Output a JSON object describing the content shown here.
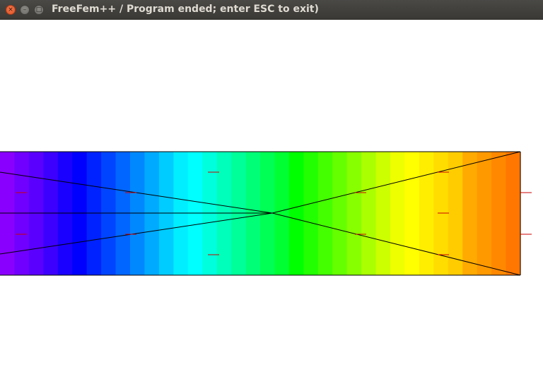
{
  "window": {
    "title": "FreeFem++ / Program ended; enter ESC to exit)",
    "close_glyph": "×",
    "minimize_glyph": "–",
    "maximize_glyph": "□",
    "icons": {
      "close": "close-icon",
      "minimize": "minimize-icon",
      "maximize": "maximize-icon"
    }
  },
  "plot": {
    "background": "#ffffff",
    "mesh_edge_color": "#000000",
    "marker_color": "#cc0000",
    "color_bands": [
      "#8a00ff",
      "#7000ff",
      "#5a00ff",
      "#3c00ff",
      "#1a00ff",
      "#0000ff",
      "#0022ff",
      "#0044ff",
      "#0066ff",
      "#0088ff",
      "#00aaff",
      "#00ccff",
      "#00eeff",
      "#00ffff",
      "#00ffdd",
      "#00ffbb",
      "#00ff99",
      "#00ff77",
      "#00ff55",
      "#00ff33",
      "#00ff00",
      "#22ff00",
      "#44ff00",
      "#66ff00",
      "#88ff00",
      "#aaff00",
      "#ccff00",
      "#eeff00",
      "#ffff00",
      "#ffee00",
      "#ffdd00",
      "#ffcc00",
      "#ffaa00",
      "#ff9900",
      "#ff8800",
      "#ff7700"
    ]
  }
}
